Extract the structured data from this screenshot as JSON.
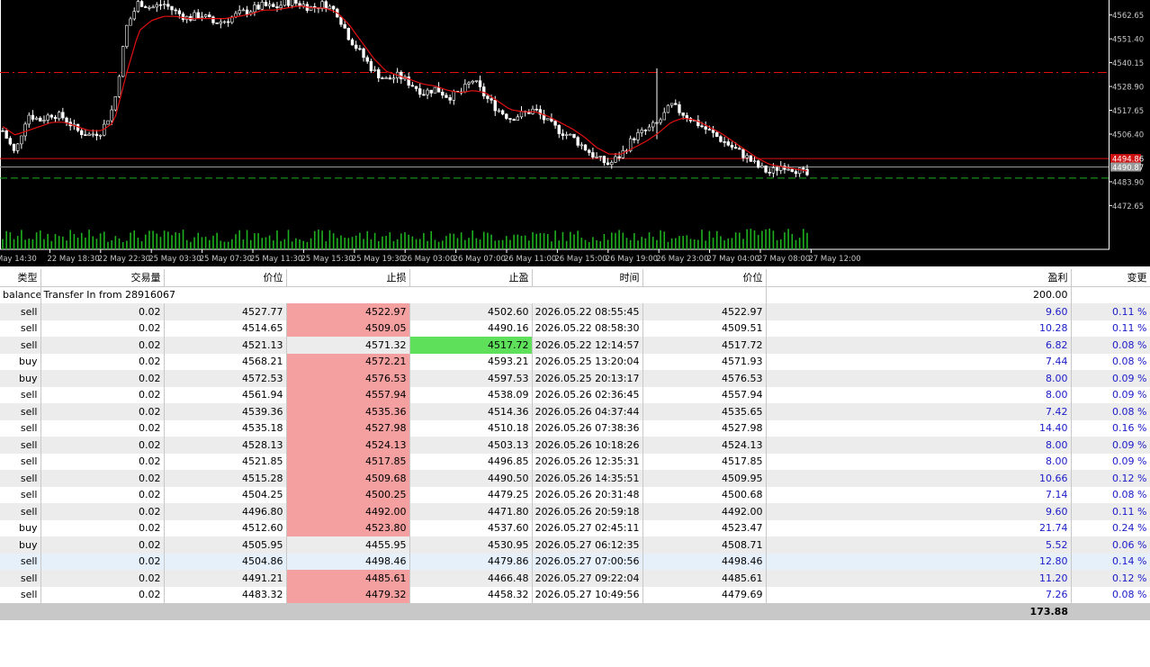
{
  "chart_data": {
    "type": "candlestick",
    "price_axis_ticks": [
      "4562.65",
      "4551.40",
      "4540.15",
      "4528.90",
      "4517.65",
      "4506.40",
      "4494.86",
      "4490.87",
      "4483.90",
      "4472.65"
    ],
    "price_range": [
      4466,
      4574
    ],
    "current_price_label": "4494.86",
    "bid_price_label": "4490.87",
    "time_axis_labels": [
      "May 14:30",
      "22 May 18:30",
      "22 May 22:30",
      "25 May 03:30",
      "25 May 07:30",
      "25 May 11:30",
      "25 May 15:30",
      "25 May 19:30",
      "26 May 03:00",
      "26 May 07:00",
      "26 May 11:00",
      "26 May 15:00",
      "26 May 19:00",
      "26 May 23:00",
      "27 May 04:00",
      "27 May 08:00",
      "27 May 12:00"
    ],
    "close_path": [
      4508,
      4497,
      4516,
      4513,
      4516,
      4514,
      4508,
      4506,
      4508,
      4520,
      4557,
      4569,
      4566,
      4568,
      4564,
      4561,
      4563,
      4559,
      4560,
      4563,
      4565,
      4567,
      4566,
      4569,
      4568,
      4566,
      4568,
      4564,
      4552,
      4544,
      4536,
      4532,
      4534,
      4530,
      4526,
      4528,
      4524,
      4526,
      4532,
      4524,
      4518,
      4514,
      4516,
      4518,
      4512,
      4508,
      4505,
      4500,
      4495,
      4492,
      4497,
      4505,
      4508,
      4512,
      4520,
      4516,
      4512,
      4508,
      4504,
      4500,
      4496,
      4491,
      4488,
      4492,
      4490,
      4487
    ],
    "ma_path": [
      4510,
      4506,
      4508,
      4510,
      4512,
      4512,
      4510,
      4508,
      4508,
      4512,
      4535,
      4555,
      4560,
      4562,
      4562,
      4561,
      4561,
      4561,
      4561,
      4562,
      4563,
      4565,
      4565,
      4566,
      4567,
      4566,
      4566,
      4564,
      4558,
      4550,
      4542,
      4536,
      4534,
      4532,
      4530,
      4529,
      4527,
      4526,
      4527,
      4526,
      4522,
      4518,
      4517,
      4517,
      4515,
      4512,
      4509,
      4505,
      4500,
      4497,
      4497,
      4500,
      4503,
      4507,
      4512,
      4514,
      4513,
      4510,
      4507,
      4503,
      4499,
      4495,
      4492,
      4491,
      4490,
      4489
    ],
    "levels": [
      {
        "label": "SL/TP dash-dot",
        "value": 4535.5,
        "color": "#e01010"
      },
      {
        "label": "current",
        "value": 4494.86,
        "color": "#e01010"
      },
      {
        "label": "bid",
        "value": 4490.87,
        "color": "#9a9a9a"
      },
      {
        "label": "green dash",
        "value": 4485.6,
        "color": "#1fb01f"
      }
    ],
    "colors": {
      "background": "#000000",
      "candle": "#ffffff",
      "ma": "#e01010",
      "volume": "#1fb01f",
      "axis_text": "#c8c8c8"
    }
  },
  "table": {
    "headers": [
      "类型",
      "交易量",
      "价位",
      "止损",
      "止盈",
      "时间",
      "价位",
      "盈利",
      "变更"
    ],
    "balance_row": {
      "type": "balance",
      "comment": "Transfer In from 28916067",
      "profit": "200.00"
    },
    "rows": [
      {
        "type": "sell",
        "volume": "0.02",
        "open": "4527.77",
        "sl": "4522.97",
        "tp": "4502.60",
        "time": "2026.05.22 08:55:45",
        "close": "4522.97",
        "profit": "9.60",
        "change": "0.11 %",
        "hit": "sl"
      },
      {
        "type": "sell",
        "volume": "0.02",
        "open": "4514.65",
        "sl": "4509.05",
        "tp": "4490.16",
        "time": "2026.05.22 08:58:30",
        "close": "4509.51",
        "profit": "10.28",
        "change": "0.11 %",
        "hit": "sl"
      },
      {
        "type": "sell",
        "volume": "0.02",
        "open": "4521.13",
        "sl": "4571.32",
        "tp": "4517.72",
        "time": "2026.05.22 12:14:57",
        "close": "4517.72",
        "profit": "6.82",
        "change": "0.08 %",
        "hit": "tp"
      },
      {
        "type": "buy",
        "volume": "0.02",
        "open": "4568.21",
        "sl": "4572.21",
        "tp": "4593.21",
        "time": "2026.05.25 13:20:04",
        "close": "4571.93",
        "profit": "7.44",
        "change": "0.08 %",
        "hit": "sl"
      },
      {
        "type": "buy",
        "volume": "0.02",
        "open": "4572.53",
        "sl": "4576.53",
        "tp": "4597.53",
        "time": "2026.05.25 20:13:17",
        "close": "4576.53",
        "profit": "8.00",
        "change": "0.09 %",
        "hit": "sl"
      },
      {
        "type": "sell",
        "volume": "0.02",
        "open": "4561.94",
        "sl": "4557.94",
        "tp": "4538.09",
        "time": "2026.05.26 02:36:45",
        "close": "4557.94",
        "profit": "8.00",
        "change": "0.09 %",
        "hit": "sl"
      },
      {
        "type": "sell",
        "volume": "0.02",
        "open": "4539.36",
        "sl": "4535.36",
        "tp": "4514.36",
        "time": "2026.05.26 04:37:44",
        "close": "4535.65",
        "profit": "7.42",
        "change": "0.08 %",
        "hit": "sl"
      },
      {
        "type": "sell",
        "volume": "0.02",
        "open": "4535.18",
        "sl": "4527.98",
        "tp": "4510.18",
        "time": "2026.05.26 07:38:36",
        "close": "4527.98",
        "profit": "14.40",
        "change": "0.16 %",
        "hit": "sl"
      },
      {
        "type": "sell",
        "volume": "0.02",
        "open": "4528.13",
        "sl": "4524.13",
        "tp": "4503.13",
        "time": "2026.05.26 10:18:26",
        "close": "4524.13",
        "profit": "8.00",
        "change": "0.09 %",
        "hit": "sl"
      },
      {
        "type": "sell",
        "volume": "0.02",
        "open": "4521.85",
        "sl": "4517.85",
        "tp": "4496.85",
        "time": "2026.05.26 12:35:31",
        "close": "4517.85",
        "profit": "8.00",
        "change": "0.09 %",
        "hit": "sl"
      },
      {
        "type": "sell",
        "volume": "0.02",
        "open": "4515.28",
        "sl": "4509.68",
        "tp": "4490.50",
        "time": "2026.05.26 14:35:51",
        "close": "4509.95",
        "profit": "10.66",
        "change": "0.12 %",
        "hit": "sl"
      },
      {
        "type": "sell",
        "volume": "0.02",
        "open": "4504.25",
        "sl": "4500.25",
        "tp": "4479.25",
        "time": "2026.05.26 20:31:48",
        "close": "4500.68",
        "profit": "7.14",
        "change": "0.08 %",
        "hit": "sl"
      },
      {
        "type": "sell",
        "volume": "0.02",
        "open": "4496.80",
        "sl": "4492.00",
        "tp": "4471.80",
        "time": "2026.05.26 20:59:18",
        "close": "4492.00",
        "profit": "9.60",
        "change": "0.11 %",
        "hit": "sl"
      },
      {
        "type": "buy",
        "volume": "0.02",
        "open": "4512.60",
        "sl": "4523.80",
        "tp": "4537.60",
        "time": "2026.05.27 02:45:11",
        "close": "4523.47",
        "profit": "21.74",
        "change": "0.24 %",
        "hit": "sl"
      },
      {
        "type": "buy",
        "volume": "0.02",
        "open": "4505.95",
        "sl": "4455.95",
        "tp": "4530.95",
        "time": "2026.05.27 06:12:35",
        "close": "4508.71",
        "profit": "5.52",
        "change": "0.06 %",
        "hit": ""
      },
      {
        "type": "sell",
        "volume": "0.02",
        "open": "4504.86",
        "sl": "4498.46",
        "tp": "4479.86",
        "time": "2026.05.27 07:00:56",
        "close": "4498.46",
        "profit": "12.80",
        "change": "0.14 %",
        "hit": ""
      },
      {
        "type": "sell",
        "volume": "0.02",
        "open": "4491.21",
        "sl": "4485.61",
        "tp": "4466.48",
        "time": "2026.05.27 09:22:04",
        "close": "4485.61",
        "profit": "11.20",
        "change": "0.12 %",
        "hit": "sl"
      },
      {
        "type": "sell",
        "volume": "0.02",
        "open": "4483.32",
        "sl": "4479.32",
        "tp": "4458.32",
        "time": "2026.05.27 10:49:56",
        "close": "4479.69",
        "profit": "7.26",
        "change": "0.08 %",
        "hit": "sl"
      }
    ],
    "total": "173.88"
  }
}
